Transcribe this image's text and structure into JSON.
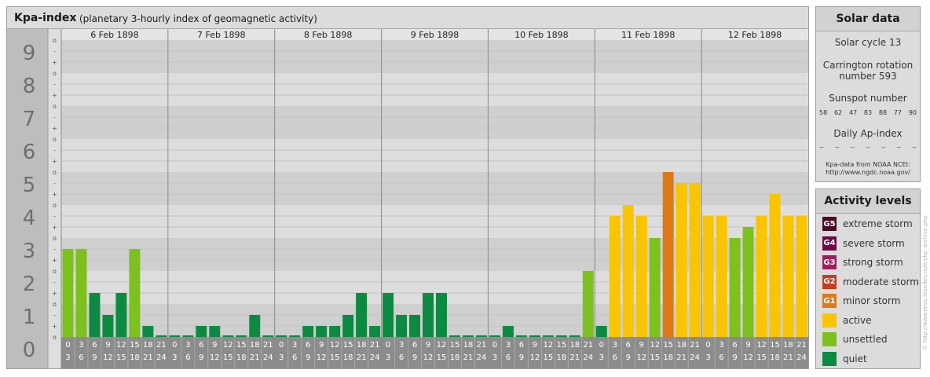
{
  "header": {
    "title": "Kpa-index",
    "subtitle": "(planetary 3-hourly index of geomagnetic activity)"
  },
  "chart_data": {
    "type": "bar",
    "title": "Kpa-index",
    "subtitle": "(planetary 3-hourly index of geomagnetic activity)",
    "ylim": [
      0,
      9
    ],
    "y_ticks": [
      "0",
      "1",
      "2",
      "3",
      "4",
      "5",
      "6",
      "7",
      "8",
      "9"
    ],
    "y_minor_marks": [
      "+",
      "-",
      "o"
    ],
    "days": [
      "6 Feb 1898",
      "7 Feb 1898",
      "8 Feb 1898",
      "9 Feb 1898",
      "10 Feb 1898",
      "11 Feb 1898",
      "12 Feb 1898"
    ],
    "interval_labels": [
      [
        "0",
        "3"
      ],
      [
        "3",
        "6"
      ],
      [
        "6",
        "9"
      ],
      [
        "9",
        "12"
      ],
      [
        "12",
        "15"
      ],
      [
        "15",
        "18"
      ],
      [
        "18",
        "21"
      ],
      [
        "21",
        "24"
      ]
    ],
    "values": [
      [
        2.667,
        2.667,
        1.333,
        0.667,
        1.333,
        2.667,
        0.333,
        0
      ],
      [
        0,
        0,
        0.333,
        0.333,
        0,
        0,
        0.667,
        0
      ],
      [
        0,
        0,
        0.333,
        0.333,
        0.333,
        0.667,
        1.333,
        0.333
      ],
      [
        1.333,
        0.667,
        0.667,
        1.333,
        1.333,
        0,
        0,
        0
      ],
      [
        0,
        0.333,
        0,
        0,
        0,
        0,
        0,
        2
      ],
      [
        0.333,
        3.667,
        4,
        3.667,
        3,
        5,
        4.667,
        4.667
      ],
      [
        3.667,
        3.667,
        3,
        3.333,
        3.667,
        4.333,
        3.667,
        3.667
      ]
    ],
    "colors": {
      "quiet": "#0d8a42",
      "unsettled": "#7dc11e",
      "active": "#f9c400",
      "minor": "#e07818",
      "moderate": "#c83c1c",
      "strong": "#a01e5a",
      "severe": "#6e0a46",
      "extreme": "#4a0a26"
    },
    "band_colors": [
      "#cfcfcf",
      "#dddddd"
    ]
  },
  "solar": {
    "title": "Solar data",
    "cycle": "Solar cycle 13",
    "carrington_1": "Carrington rotation",
    "carrington_2": "number 593",
    "sunspot_label": "Sunspot number",
    "sunspots": [
      "58",
      "62",
      "47",
      "83",
      "88",
      "77",
      "90"
    ],
    "ap_label": "Daily Ap-index",
    "ap_values": [
      "--",
      "--",
      "--",
      "--",
      "--",
      "--",
      "--"
    ],
    "source_1": "Kpa-data from NOAA NCEI:",
    "source_2": "http://www.ngdc.noaa.gov/"
  },
  "activity": {
    "title": "Activity levels",
    "items": [
      {
        "code": "G5",
        "label": "extreme storm",
        "color": "#4a0a26"
      },
      {
        "code": "G4",
        "label": "severe storm",
        "color": "#6e0a46"
      },
      {
        "code": "G3",
        "label": "strong storm",
        "color": "#a01e5a"
      },
      {
        "code": "G2",
        "label": "moderate storm",
        "color": "#c83c1c"
      },
      {
        "code": "G1",
        "label": "minor storm",
        "color": "#e07818"
      },
      {
        "code": "",
        "label": "active",
        "color": "#f9c400"
      },
      {
        "code": "",
        "label": "unsettled",
        "color": "#7dc11e"
      },
      {
        "code": "",
        "label": "quiet",
        "color": "#0d8a42"
      }
    ]
  },
  "credit": "© http://www.tesis.lebedev.ru/en/kp_archive.php"
}
